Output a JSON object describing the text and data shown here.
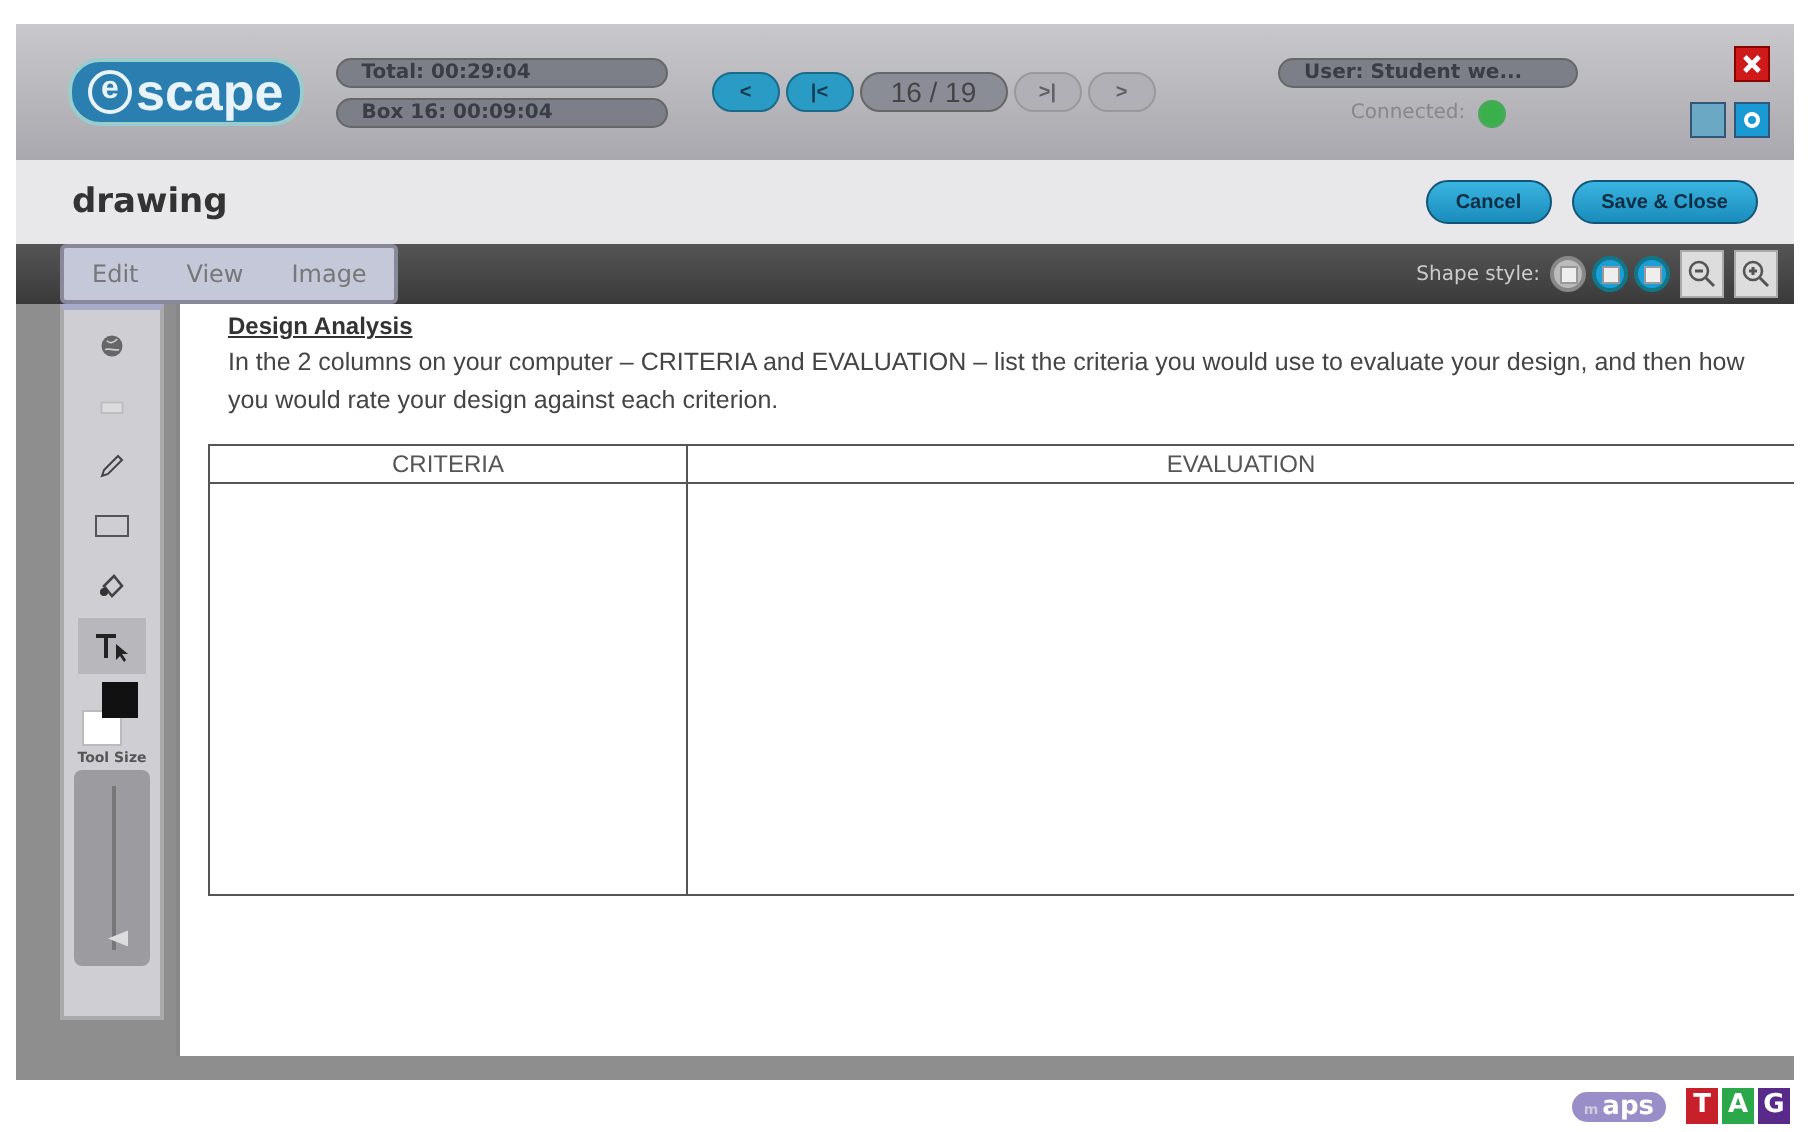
{
  "header": {
    "logo": {
      "mark": "e",
      "text": "scape"
    },
    "timers": [
      "Total: 00:29:04",
      "Box 16: 00:09:04"
    ],
    "nav": [
      {
        "label": "<",
        "disabled": false
      },
      {
        "label": "|<",
        "disabled": false
      },
      {
        "label": "16 / 19",
        "kind": "counter",
        "disabled": false
      },
      {
        "label": ">|",
        "disabled": true
      },
      {
        "label": ">",
        "disabled": true
      }
    ],
    "user": "User: Student we...",
    "connection": {
      "label": "Connected:",
      "connected": true
    }
  },
  "title": "drawing",
  "buttons": [
    "Cancel",
    "Save & Close"
  ],
  "menu": [
    "Edit",
    "View",
    "Image"
  ],
  "shape_style": {
    "label": "Shape style:",
    "options": [
      {
        "selected": false
      },
      {
        "selected": true
      },
      {
        "selected": true
      }
    ]
  },
  "tools": [
    {
      "kind": "globe",
      "selected": false
    },
    {
      "kind": "eraser",
      "selected": false
    },
    {
      "kind": "pencil",
      "selected": false
    },
    {
      "kind": "rectangle",
      "selected": false
    },
    {
      "kind": "fill",
      "selected": false
    },
    {
      "kind": "text",
      "selected": true
    }
  ],
  "tool_size": {
    "label": "Tool Size",
    "level": 0.05
  },
  "canvas": {
    "heading": "Design Analysis",
    "text": "In the 2 columns on your computer – CRITERIA and EVALUATION – list the criteria you would use to evaluate your design, and then how you would rate your design against each criterion.",
    "columns": [
      "CRITERIA",
      "EVALUATION"
    ]
  },
  "footer": {
    "maps": {
      "prefix": "m",
      "text": "aps"
    },
    "tags": [
      {
        "letter": "T",
        "color": "#c8202a"
      },
      {
        "letter": "A",
        "color": "#2aa84a"
      },
      {
        "letter": "G",
        "color": "#5a2a8a"
      }
    ]
  }
}
